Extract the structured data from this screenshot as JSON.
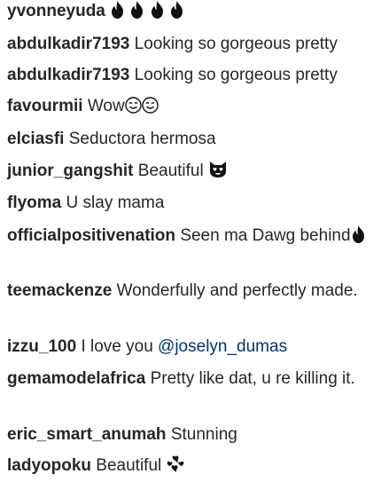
{
  "comments": [
    {
      "username": "yvonneyuda",
      "text": "",
      "icons": [
        "fire-icon",
        "fire-icon",
        "fire-icon",
        "fire-icon"
      ]
    },
    {
      "username": "abdulkadir7193",
      "text": "Looking so gorgeous pretty"
    },
    {
      "username": "abdulkadir7193",
      "text": "Looking so gorgeous pretty"
    },
    {
      "username": "favourmii",
      "text": "Wow",
      "icons": [
        "smiling-face-icon",
        "smiling-face-icon"
      ]
    },
    {
      "username": "elciasfi",
      "text": "Seductora hermosa"
    },
    {
      "username": "junior_gangshit",
      "text": "Beautiful",
      "icons": [
        "heart-eyes-cat-icon"
      ]
    },
    {
      "username": "flyoma",
      "text": "U slay mama"
    },
    {
      "username": "officialpositivenation",
      "text": "Seen ma Dawg behind",
      "icons": [
        "fire-icon"
      ]
    },
    {
      "username": "teemackenze",
      "text": "Wonderfully and perfectly made."
    },
    {
      "username": "izzu_100",
      "text": "I love you",
      "mention": "@joselyn_dumas"
    },
    {
      "username": "gemamodelafrica",
      "text": "Pretty like dat, u re killing it."
    },
    {
      "username": "eric_smart_anumah",
      "text": "Stunning"
    },
    {
      "username": "ladyopoku",
      "text": "Beautiful",
      "icons": [
        "revolving-hearts-icon"
      ]
    }
  ]
}
